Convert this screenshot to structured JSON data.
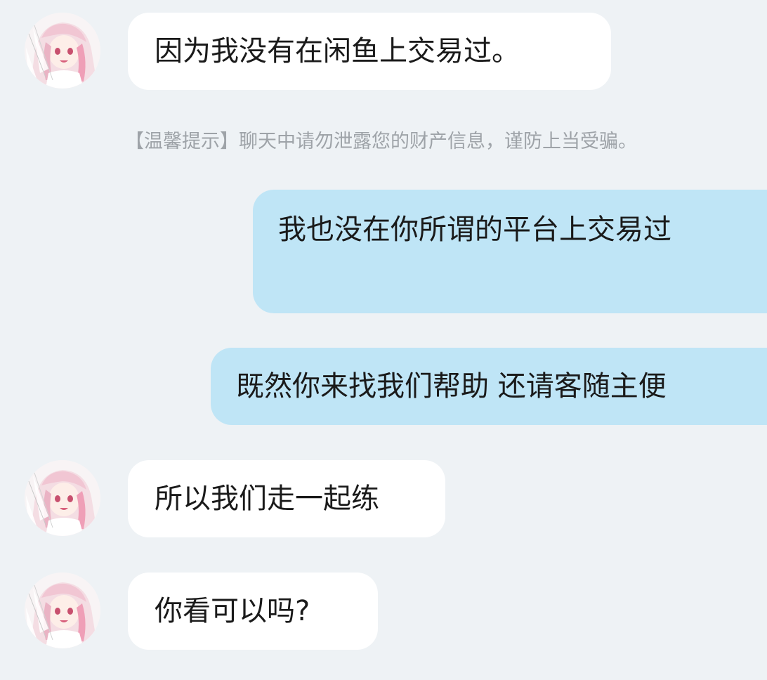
{
  "messages": [
    {
      "sender": "contact",
      "text": "因为我没有在闲鱼上交易过。"
    },
    {
      "sender": "me",
      "text": "我也没在你所谓的平台上交易过"
    },
    {
      "sender": "me",
      "text": "既然你来找我们帮助 还请客随主便"
    },
    {
      "sender": "contact",
      "text": "所以我们走一起练"
    },
    {
      "sender": "contact",
      "text": "你看可以吗?"
    }
  ],
  "system_notice": "【温馨提示】聊天中请勿泄露您的财产信息，谨防上当受骗。",
  "colors": {
    "background": "#eef2f5",
    "incoming_bubble": "#ffffff",
    "outgoing_bubble": "#bfe5f6",
    "notice_text": "#9ea3a8"
  },
  "icons": {
    "contact_avatar": "anime-girl-avatar-icon"
  }
}
